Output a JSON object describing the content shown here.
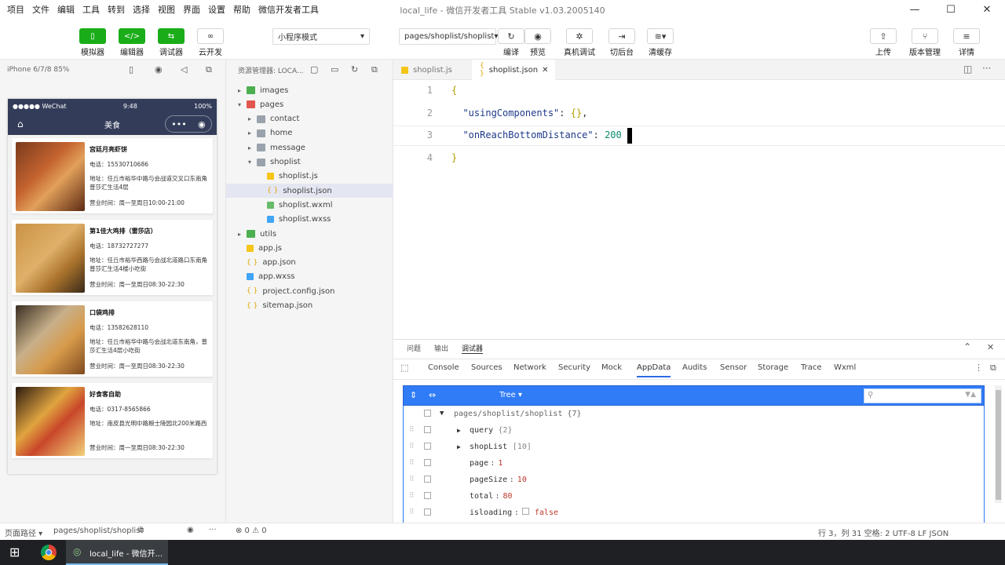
{
  "menubar": {
    "items": [
      "项目",
      "文件",
      "编辑",
      "工具",
      "转到",
      "选择",
      "视图",
      "界面",
      "设置",
      "帮助",
      "微信开发者工具"
    ],
    "window_title": "local_life - 微信开发者工具 Stable v1.03.2005140"
  },
  "toolbar": {
    "simulator": "模拟器",
    "editor": "编辑器",
    "debugger": "调试器",
    "cloud": "云开发",
    "mode": "小程序模式",
    "page_path": "pages/shoplist/shoplist",
    "compile": "编译",
    "preview": "预览",
    "remote_debug": "真机调试",
    "background": "切后台",
    "clear_cache": "清缓存",
    "upload": "上传",
    "version": "版本管理",
    "details": "详情"
  },
  "simulator": {
    "device": "iPhone 6/7/8 85%",
    "carrier": "●●●●● WeChat",
    "time": "9:48",
    "battery": "100%",
    "nav_title": "美食",
    "shops": [
      {
        "name": "宫廷月亮虾饼",
        "phone": "电话：15530710686",
        "address": "地址：任丘市裕华中路与会战道交叉口东南角普莎汇生活4层",
        "hours": "营业时间：周一至周日10:00-21:00"
      },
      {
        "name": "第1佳大鸡排（雷莎店）",
        "phone": "电话：18732727277",
        "address": "地址：任丘市裕华西路与会战北道路口东南角普莎汇生活4楼小吃街",
        "hours": "营业时间：周一至周日08:30-22:30"
      },
      {
        "name": "口袋鸡排",
        "phone": "电话：13582628110",
        "address": "地址：任丘市裕华中路与会战北道东南角，普莎汇生活4层小吃街",
        "hours": "营业时间：周一至周日08:30-22:30"
      },
      {
        "name": "好食客自助",
        "phone": "电话：0317-8565866",
        "address": "地址：南皮县光明中路粮士陵园北200米路西",
        "hours": "营业时间：周一至周日08:30-22:30"
      }
    ]
  },
  "explorer": {
    "title": "资源管理器: LOCA...",
    "tree": [
      {
        "label": "images",
        "type": "folder-green",
        "depth": 1,
        "arrow": "▸"
      },
      {
        "label": "pages",
        "type": "folder-red",
        "depth": 1,
        "arrow": "▾"
      },
      {
        "label": "contact",
        "type": "folder",
        "depth": 2,
        "arrow": "▸"
      },
      {
        "label": "home",
        "type": "folder",
        "depth": 2,
        "arrow": "▸"
      },
      {
        "label": "message",
        "type": "folder",
        "depth": 2,
        "arrow": "▸"
      },
      {
        "label": "shoplist",
        "type": "folder",
        "depth": 2,
        "arrow": "▾"
      },
      {
        "label": "shoplist.js",
        "type": "js",
        "depth": 3,
        "arrow": ""
      },
      {
        "label": "shoplist.json",
        "type": "json",
        "depth": 3,
        "arrow": ""
      },
      {
        "label": "shoplist.wxml",
        "type": "wxml",
        "depth": 3,
        "arrow": ""
      },
      {
        "label": "shoplist.wxss",
        "type": "wxss",
        "depth": 3,
        "arrow": ""
      },
      {
        "label": "utils",
        "type": "folder-green",
        "depth": 1,
        "arrow": "▸"
      },
      {
        "label": "app.js",
        "type": "js",
        "depth": 1,
        "arrow": ""
      },
      {
        "label": "app.json",
        "type": "json",
        "depth": 1,
        "arrow": ""
      },
      {
        "label": "app.wxss",
        "type": "wxss",
        "depth": 1,
        "arrow": ""
      },
      {
        "label": "project.config.json",
        "type": "json",
        "depth": 1,
        "arrow": ""
      },
      {
        "label": "sitemap.json",
        "type": "json",
        "depth": 1,
        "arrow": ""
      }
    ]
  },
  "editor": {
    "tabs": [
      "shoplist.js",
      "shoplist.json"
    ],
    "lines": [
      {
        "n": "1",
        "text": "{"
      },
      {
        "n": "2",
        "text": "  \"usingComponents\": {},"
      },
      {
        "n": "3",
        "text": "  \"onReachBottomDistance\": 200"
      },
      {
        "n": "4",
        "text": "}"
      }
    ]
  },
  "panel": {
    "tabs": [
      "问题",
      "输出",
      "调试器"
    ],
    "devtabs": [
      "Console",
      "Sources",
      "Network",
      "Security",
      "Mock",
      "AppData",
      "Audits",
      "Sensor",
      "Storage",
      "Trace",
      "Wxml"
    ],
    "view_mode": "Tree ▾",
    "root": "pages/shoplist/shoplist {7}",
    "rows": [
      {
        "key": "query",
        "value": "{2}",
        "expandable": true
      },
      {
        "key": "shopList",
        "value": "[10]",
        "expandable": true
      },
      {
        "key": "page",
        "value": "1",
        "expandable": false
      },
      {
        "key": "pageSize",
        "value": "10",
        "expandable": false
      },
      {
        "key": "total",
        "value": "80",
        "expandable": false
      },
      {
        "key": "isloading",
        "value": "false",
        "expandable": false
      }
    ]
  },
  "statusbar": {
    "page_path_label": "页面路径 ▾",
    "page_path": "pages/shoplist/shoplist",
    "errors": "⊗ 0 ⚠ 0",
    "right": "行 3，列 31  空格: 2  UTF-8  LF  JSON"
  },
  "taskbar": {
    "app": "local_life - 微信开..."
  }
}
